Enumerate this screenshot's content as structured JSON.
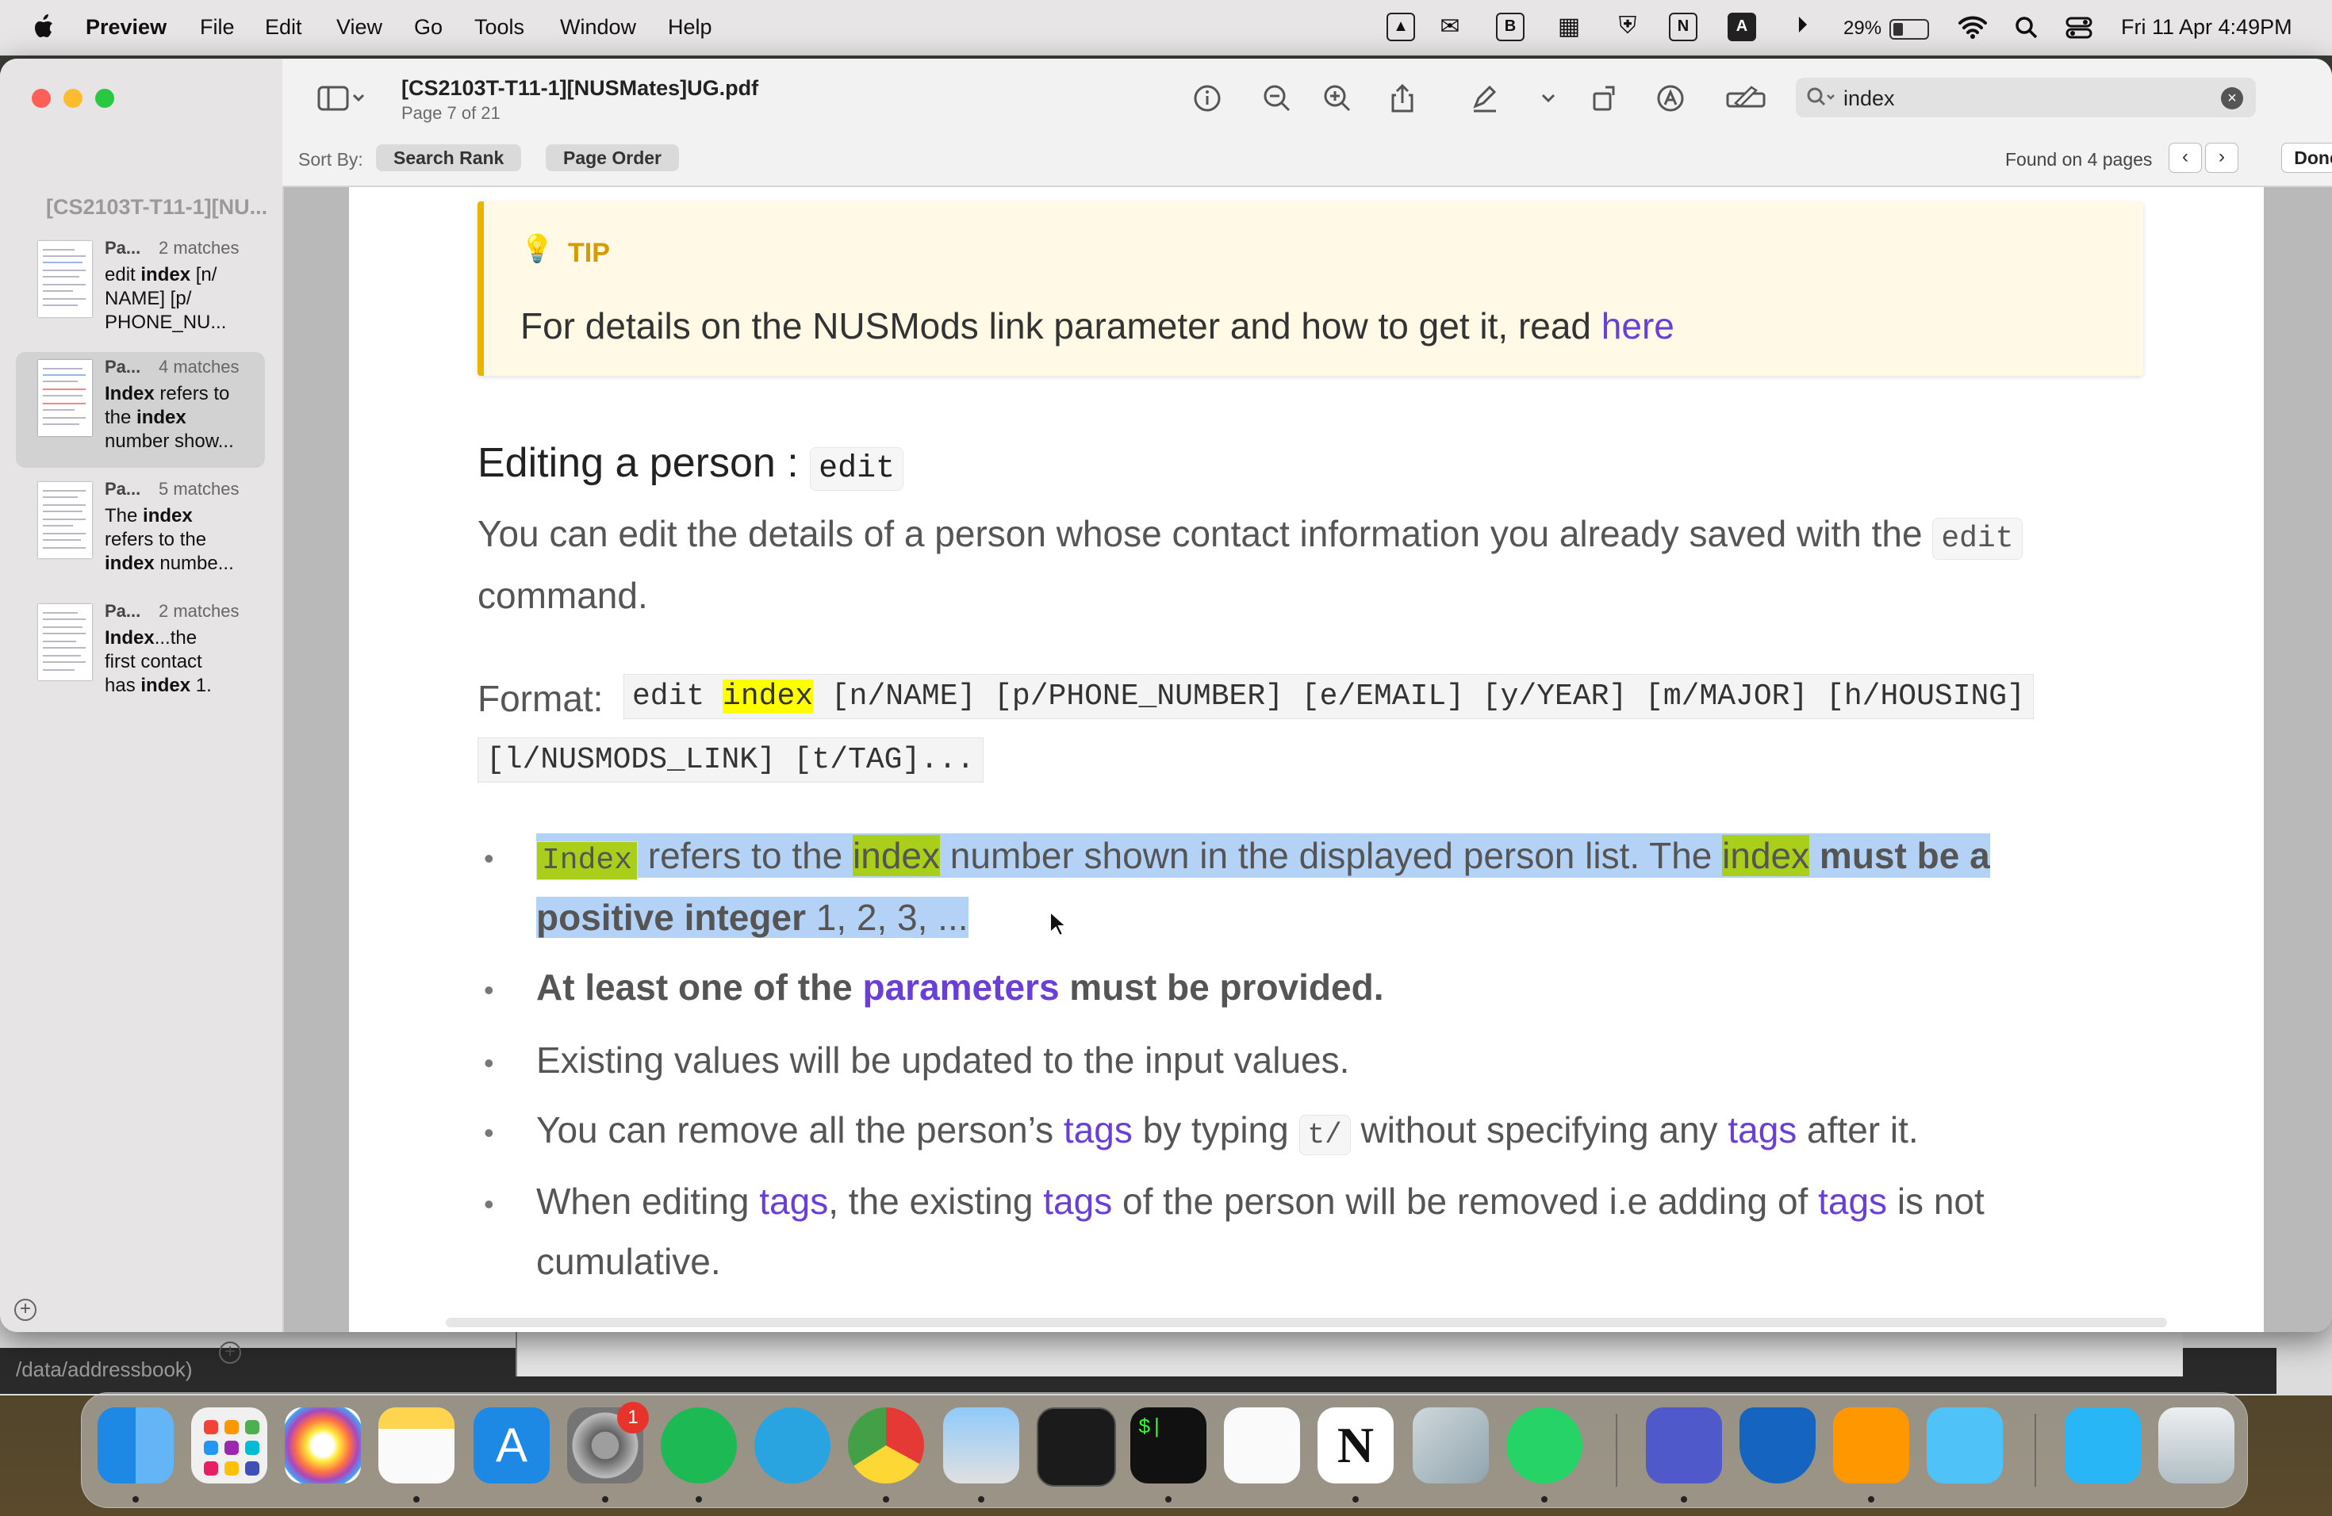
{
  "menubar": {
    "app_name": "Preview",
    "items": [
      "File",
      "Edit",
      "View",
      "Go",
      "Tools",
      "Window",
      "Help"
    ],
    "battery": "29%",
    "datetime": "Fri 11 Apr  4:49PM"
  },
  "window": {
    "doc_title": "[CS2103T-T11-1][NUSMates]UG.pdf",
    "doc_subtitle": "Page 7 of 21",
    "search_value": "index",
    "sort_label": "Sort By:",
    "sort_search_rank": "Search Rank",
    "sort_page_order": "Page Order",
    "found_text": "Found on 4 pages",
    "done_label": "Done"
  },
  "sidebar": {
    "doc_title": "[CS2103T-T11-1][NU...",
    "results": [
      {
        "page": "Pa...",
        "count": "2 matches",
        "l1_pre": "edit ",
        "l1_bold": "index",
        "l1_post": " [n/",
        "l2": "NAME] [p/",
        "l3": "PHONE_NU..."
      },
      {
        "page": "Pa...",
        "count": "4 matches",
        "l1_bold": "Index",
        "l1_post": " refers to",
        "l2_pre": "the ",
        "l2_bold": "index",
        "l3": "number show..."
      },
      {
        "page": "Pa...",
        "count": "5 matches",
        "l1_pre": "The ",
        "l1_bold": "index",
        "l2": "refers to the",
        "l3_bold": "index",
        "l3_post": " numbe..."
      },
      {
        "page": "Pa...",
        "count": "2 matches",
        "l1_bold": "Index",
        "l1_post": "...the",
        "l2": "first contact",
        "l3_pre": "has ",
        "l3_bold": "index",
        "l3_post": " 1."
      }
    ]
  },
  "page": {
    "tip_label": "TIP",
    "tip_text": "For details on the NUSMods link parameter and how to get it, read ",
    "tip_link": "here",
    "heading": "Editing a person : ",
    "heading_code": "edit",
    "intro_line1": "You can edit the details of a person whose contact information you already saved with the ",
    "intro_code": "edit",
    "intro_line2": "command.",
    "format_label": "Format: ",
    "format_code_pre": "edit ",
    "format_code_hl": "index",
    "format_code_post": " [n/NAME] [p/PHONE_NUMBER] [e/EMAIL] [y/YEAR] [m/MAJOR] [h/HOUSING]",
    "format_code_line2": "[l/NUSMODS_LINK] [t/TAG]...",
    "bullet1_code": "Index",
    "bullet1_a": " refers to the ",
    "bullet1_hl1": "index",
    "bullet1_b": " number shown in the displayed person list. The ",
    "bullet1_hl2": "index",
    "bullet1_c": " must be a",
    "bullet1_line2_bold": "positive integer",
    "bullet1_line2": " 1, 2, 3, ...",
    "bullet2_a": "At least one of the ",
    "bullet2_link": "parameters",
    "bullet2_b": " must be provided.",
    "bullet3": "Existing values will be updated to the input values.",
    "bullet4_a": "You can remove all the person’s ",
    "bullet4_link1": "tags",
    "bullet4_b": " by typing ",
    "bullet4_code": "t/",
    "bullet4_c": " without specifying any ",
    "bullet4_link2": "tags",
    "bullet4_d": " after it.",
    "bullet5_a": "When editing ",
    "bullet5_link1": "tags",
    "bullet5_b": ", the existing ",
    "bullet5_link2": "tags",
    "bullet5_c": " of the person will be removed i.e adding of ",
    "bullet5_link3": "tags",
    "bullet5_d": " is not",
    "bullet5_line2": "cumulative."
  },
  "background": {
    "terminal_path": "/data/addressbook)"
  },
  "dock": {
    "badge": "1",
    "apps": [
      "finder-icon",
      "launchpad-icon",
      "photos-icon",
      "notes-icon",
      "app-store-icon",
      "system-settings-icon",
      "spotify-icon",
      "telegram-icon",
      "chrome-icon",
      "preview-icon",
      "activity-monitor-icon",
      "terminal-icon",
      "google-drive-icon",
      "notion-icon",
      "iphone-mirroring-icon",
      "whatsapp-icon",
      "teams-icon",
      "vpn-shield-icon",
      "pages-icon",
      "folder-icon",
      "folder-downloads-icon",
      "trash-icon"
    ]
  },
  "colors": {
    "link": "#6a3fd8",
    "search_highlight": "#ffff00",
    "current_match": "#a9cf1a",
    "selection": "#b4d2f5",
    "tip_border": "#e8b600"
  }
}
